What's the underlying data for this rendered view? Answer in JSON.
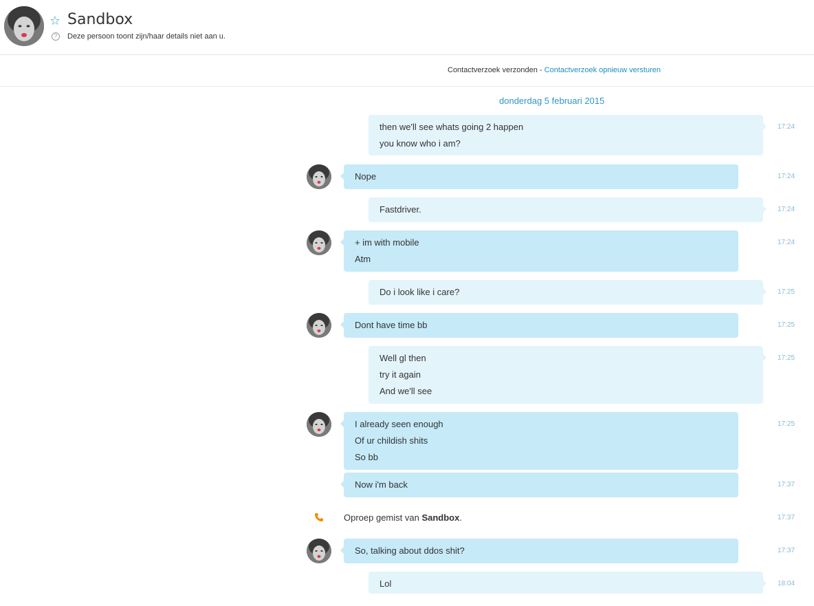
{
  "header": {
    "name": "Sandbox",
    "subtitle": "Deze persoon toont zijn/haar details niet aan u.",
    "star_icon": "star-icon",
    "info_icon": "question-icon"
  },
  "request": {
    "text": "Contactverzoek verzonden - ",
    "link": "Contactverzoek opnieuw versturen"
  },
  "date": "donderdag 5 februari 2015",
  "messages": [
    {
      "from": "me",
      "lines": [
        "then we'll see whats going 2 happen",
        "you know who i am?"
      ],
      "time": "17:24"
    },
    {
      "from": "them",
      "lines": [
        "Nope"
      ],
      "time": "17:24"
    },
    {
      "from": "me",
      "lines": [
        "Fastdriver."
      ],
      "time": "17:24"
    },
    {
      "from": "them",
      "lines": [
        "+ im with mobile",
        "Atm"
      ],
      "time": "17:24"
    },
    {
      "from": "me",
      "lines": [
        "Do i look like i care?"
      ],
      "time": "17:25"
    },
    {
      "from": "them",
      "lines": [
        "Dont have time bb"
      ],
      "time": "17:25"
    },
    {
      "from": "me",
      "lines": [
        "Well gl then",
        "try it again",
        "And we'll see"
      ],
      "time": "17:25"
    },
    {
      "from": "them",
      "lines": [
        "I already seen enough",
        "Of ur childish shits",
        "So bb"
      ],
      "time": "17:25"
    },
    {
      "from": "them",
      "lines": [
        "Now i'm back"
      ],
      "time": "17:37"
    },
    {
      "from": "them",
      "lines": [
        "So, talking about ddos shit?"
      ],
      "time": "17:37"
    },
    {
      "from": "me",
      "lines": [
        "Lol"
      ],
      "time": "18:04"
    }
  ],
  "missed_call": {
    "text": "Oproep gemist van ",
    "name": "Sandbox",
    "suffix": ".",
    "time": "17:37",
    "icon": "phone-icon",
    "icon_color": "#f08a00"
  },
  "colors": {
    "own_bubble": "#e4f4fb",
    "other_bubble": "#c6eaf8",
    "accent": "#1d8cc0",
    "time": "#8cb8d2"
  }
}
